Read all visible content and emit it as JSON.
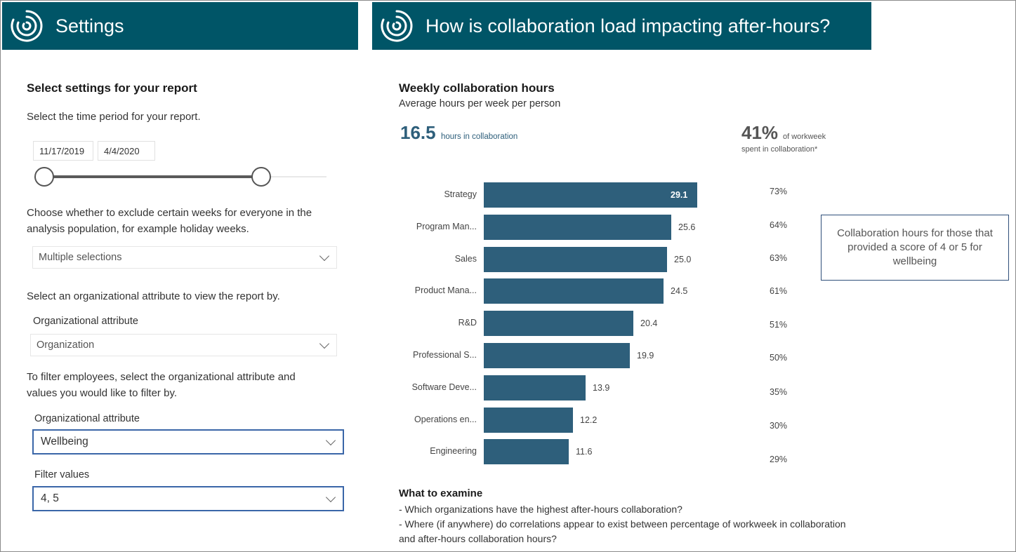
{
  "settings_panel": {
    "header_title": "Settings",
    "section_title": "Select settings for your report",
    "time_period_text": "Select the time period for your report.",
    "start_date": "11/17/2019",
    "end_date": "4/4/2020",
    "exclude_weeks_text": "Choose whether to exclude certain weeks for everyone in the analysis population, for example holiday weeks.",
    "exclude_weeks_value": "Multiple selections",
    "org_attr_text": "Select an organizational attribute to view the report by.",
    "org_attr_label": "Organizational attribute",
    "org_attr_value": "Organization",
    "filter_text": "To filter employees, select the organizational attribute and values you would like to filter by.",
    "filter_attr_label": "Organizational attribute",
    "filter_attr_value": "Wellbeing",
    "filter_values_label": "Filter values",
    "filter_values_value": "4, 5"
  },
  "report_panel": {
    "header_title": "How is collaboration load impacting after-hours?",
    "chart_title": "Weekly collaboration hours",
    "chart_subtitle": "Average hours per week per person",
    "kpi_hours_value": "16.5",
    "kpi_hours_label": "hours in collaboration",
    "kpi_pct_value": "41%",
    "kpi_pct_label_1": "of workweek",
    "kpi_pct_label_2": "spent in collaboration*",
    "note_text": "Collaboration hours for those that provided a score of 4 or 5 for wellbeing",
    "examine_title": "What to examine",
    "examine_line_1": "- Which organizations have the highest after-hours collaboration?",
    "examine_line_2": "- Where (if anywhere) do correlations appear to exist between percentage of workweek in collaboration and after-hours collaboration hours?"
  },
  "colors": {
    "header_bg": "#005567",
    "bar": "#2e5f7b",
    "kpi_value": "#2e5f7b"
  },
  "chart_data": {
    "type": "bar",
    "orientation": "horizontal",
    "categories": [
      "Strategy",
      "Program Man...",
      "Sales",
      "Product Mana...",
      "R&D",
      "Professional S...",
      "Software Deve...",
      "Operations en...",
      "Engineering"
    ],
    "values": [
      29.1,
      25.6,
      25.0,
      24.5,
      20.4,
      19.9,
      13.9,
      12.2,
      11.6
    ],
    "value_labels": [
      "29.1",
      "25.6",
      "25.0",
      "24.5",
      "20.4",
      "19.9",
      "13.9",
      "12.2",
      "11.6"
    ],
    "percent_labels": [
      "73%",
      "64%",
      "63%",
      "61%",
      "51%",
      "50%",
      "35%",
      "30%",
      "29%"
    ],
    "xlim": [
      0,
      29.1
    ],
    "grid": false,
    "legend": "none"
  }
}
